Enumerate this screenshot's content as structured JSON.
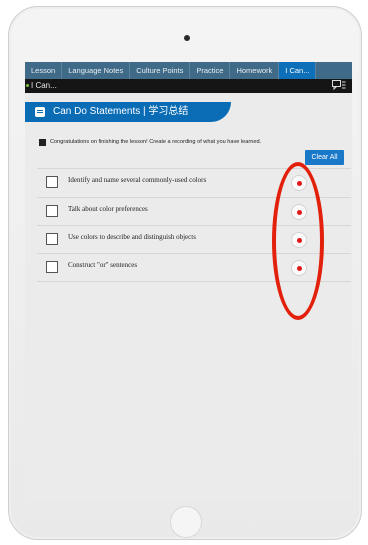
{
  "tabs": [
    {
      "label": "Lesson"
    },
    {
      "label": "Language Notes"
    },
    {
      "label": "Culture Points"
    },
    {
      "label": "Practice"
    },
    {
      "label": "Homework"
    },
    {
      "label": "I Can..."
    }
  ],
  "subbar": {
    "label": "I Can..."
  },
  "header": {
    "title": "Can Do Statements | 学习总结"
  },
  "notice": "Congratulations on finishing the lesson! Create a recording of what you have learned.",
  "clear_all_label": "Clear All",
  "statements": [
    {
      "label": "Identify and name several commonly-used colors"
    },
    {
      "label": "Talk about color preferences"
    },
    {
      "label": "Use colors to describe and distinguish objects"
    },
    {
      "label": "Construct \"or\" sentences"
    }
  ],
  "colors": {
    "tab_bar": "#3f6b88",
    "active_tab": "#0d6fb8",
    "header": "#0b6cb6",
    "record_dot": "#e01818",
    "annotation": "#e2200c"
  }
}
